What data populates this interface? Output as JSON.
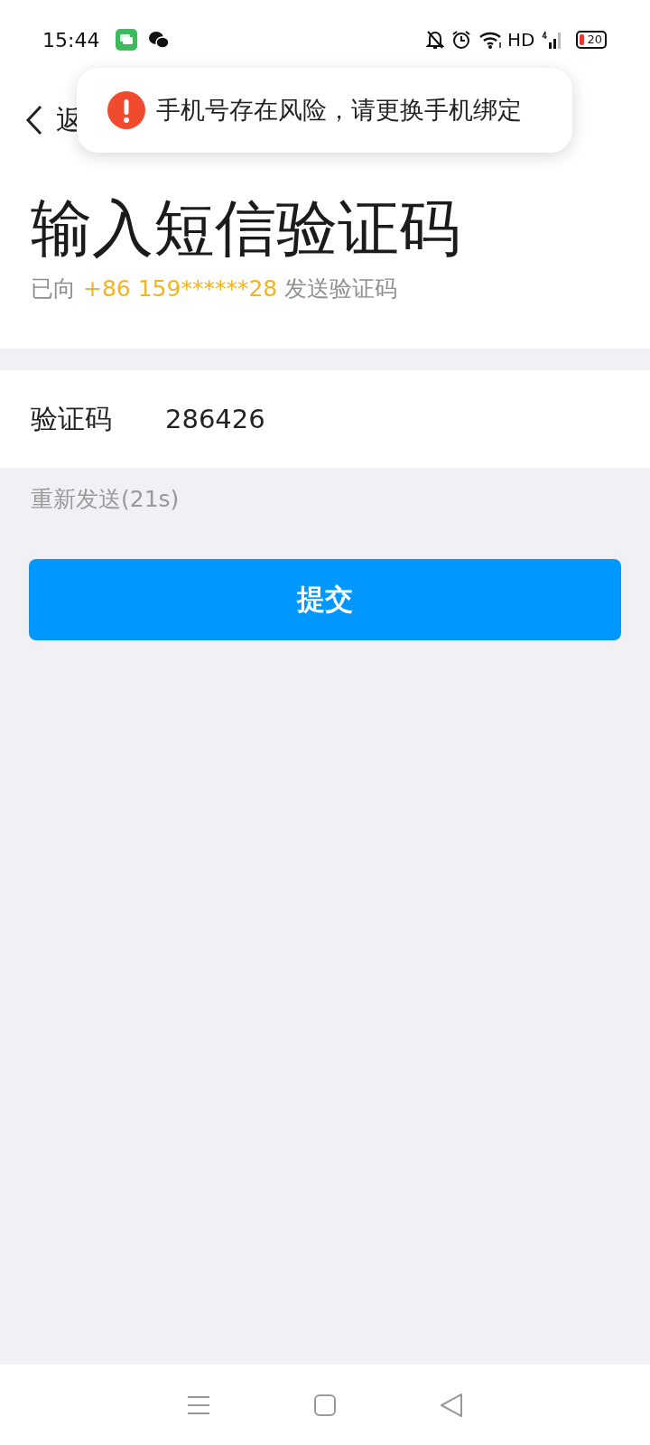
{
  "status_bar": {
    "time": "15:44",
    "network": "HD",
    "battery": "20"
  },
  "back": {
    "label": "返"
  },
  "toast": {
    "message": "手机号存在风险，请更换手机绑定"
  },
  "title": "输入短信验证码",
  "subtitle": {
    "prefix": "已向",
    "phone": "+86 159******28",
    "suffix": "发送验证码"
  },
  "code_field": {
    "label": "验证码",
    "value": "286426"
  },
  "resend": {
    "label": "重新发送(21s)",
    "disabled": true
  },
  "submit": {
    "label": "提交"
  }
}
